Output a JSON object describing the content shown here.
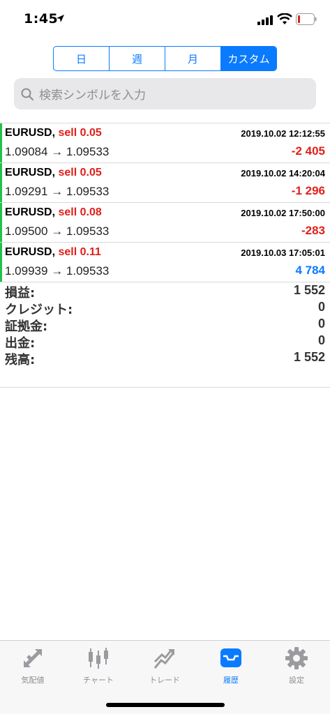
{
  "status": {
    "time": "1:45"
  },
  "segments": [
    {
      "label": "日",
      "active": false
    },
    {
      "label": "週",
      "active": false
    },
    {
      "label": "月",
      "active": false
    },
    {
      "label": "カスタム",
      "active": true
    }
  ],
  "search": {
    "placeholder": "検索シンボルを入力"
  },
  "trades": [
    {
      "symbol": "EURUSD,",
      "side": "sell 0.05",
      "time": "2019.10.02 12:12:55",
      "open": "1.09084",
      "arrow": "→",
      "close": "1.09533",
      "profit": "-2 405",
      "profit_sign": "negative"
    },
    {
      "symbol": "EURUSD,",
      "side": "sell 0.05",
      "time": "2019.10.02 14:20:04",
      "open": "1.09291",
      "arrow": "→",
      "close": "1.09533",
      "profit": "-1 296",
      "profit_sign": "negative"
    },
    {
      "symbol": "EURUSD,",
      "side": "sell 0.08",
      "time": "2019.10.02 17:50:00",
      "open": "1.09500",
      "arrow": "→",
      "close": "1.09533",
      "profit": "-283",
      "profit_sign": "negative"
    },
    {
      "symbol": "EURUSD,",
      "side": "sell 0.11",
      "time": "2019.10.03 17:05:01",
      "open": "1.09939",
      "arrow": "→",
      "close": "1.09533",
      "profit": "4 784",
      "profit_sign": "positive"
    }
  ],
  "summary": [
    {
      "label": "損益:",
      "value": "1 552"
    },
    {
      "label": "クレジット:",
      "value": "0"
    },
    {
      "label": "証拠金:",
      "value": "0"
    },
    {
      "label": "出金:",
      "value": "0"
    },
    {
      "label": "残高:",
      "value": "1 552"
    }
  ],
  "tabs": [
    {
      "label": "気配値",
      "icon": "quotes-icon",
      "active": false
    },
    {
      "label": "チャート",
      "icon": "candlestick-icon",
      "active": false
    },
    {
      "label": "トレード",
      "icon": "trade-icon",
      "active": false
    },
    {
      "label": "履歴",
      "icon": "history-inbox-icon",
      "active": true
    },
    {
      "label": "設定",
      "icon": "gear-icon",
      "active": false
    }
  ],
  "colors": {
    "accent": "#0a7aff",
    "negative": "#e0201b",
    "buy_bar": "#21c14b"
  }
}
